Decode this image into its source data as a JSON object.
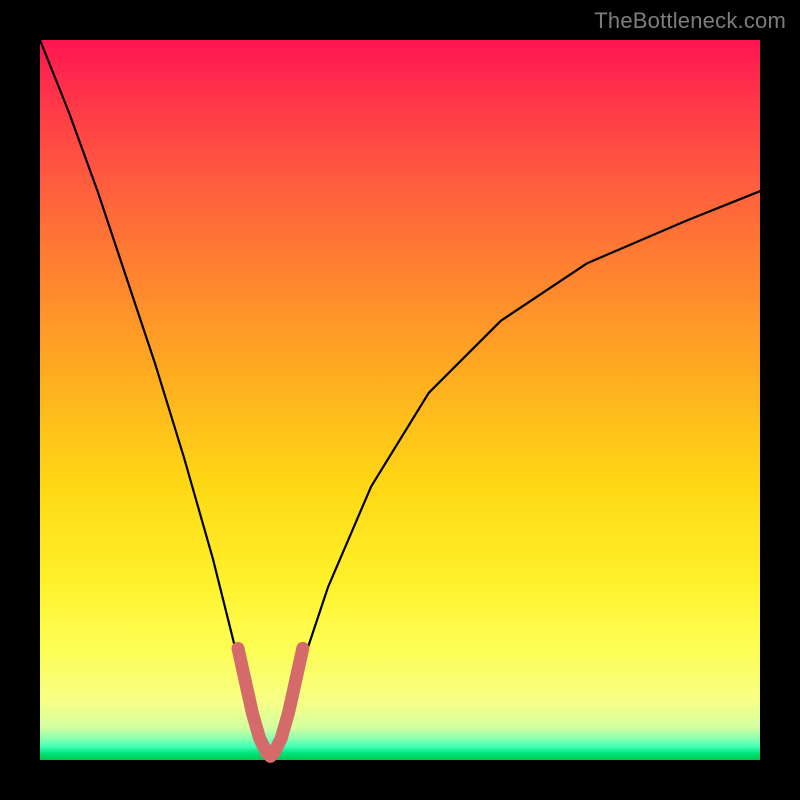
{
  "watermark": "TheBottleneck.com",
  "chart_data": {
    "type": "line",
    "title": "",
    "xlabel": "",
    "ylabel": "",
    "xlim": [
      0,
      100
    ],
    "ylim": [
      0,
      100
    ],
    "series": [
      {
        "name": "bottleneck-curve",
        "x": [
          0,
          4,
          8,
          12,
          16,
          20,
          24,
          26,
          28,
          30,
          31,
          32,
          33,
          34,
          36,
          40,
          46,
          54,
          64,
          76,
          90,
          100
        ],
        "y": [
          100,
          90,
          79,
          67,
          55,
          42,
          28,
          20,
          12,
          4,
          1,
          0,
          1,
          4,
          12,
          24,
          38,
          51,
          61,
          69,
          75,
          79
        ]
      },
      {
        "name": "highlight-valley",
        "x": [
          27.5,
          28.5,
          29.5,
          30.5,
          31.5,
          32.0,
          32.5,
          33.5,
          34.5,
          35.5,
          36.5
        ],
        "y": [
          15.5,
          11.0,
          6.5,
          3.0,
          1.0,
          0.5,
          1.0,
          3.0,
          6.5,
          11.0,
          15.5
        ]
      }
    ],
    "colors": {
      "curve": "#000000",
      "highlight": "#d46a6a"
    }
  }
}
